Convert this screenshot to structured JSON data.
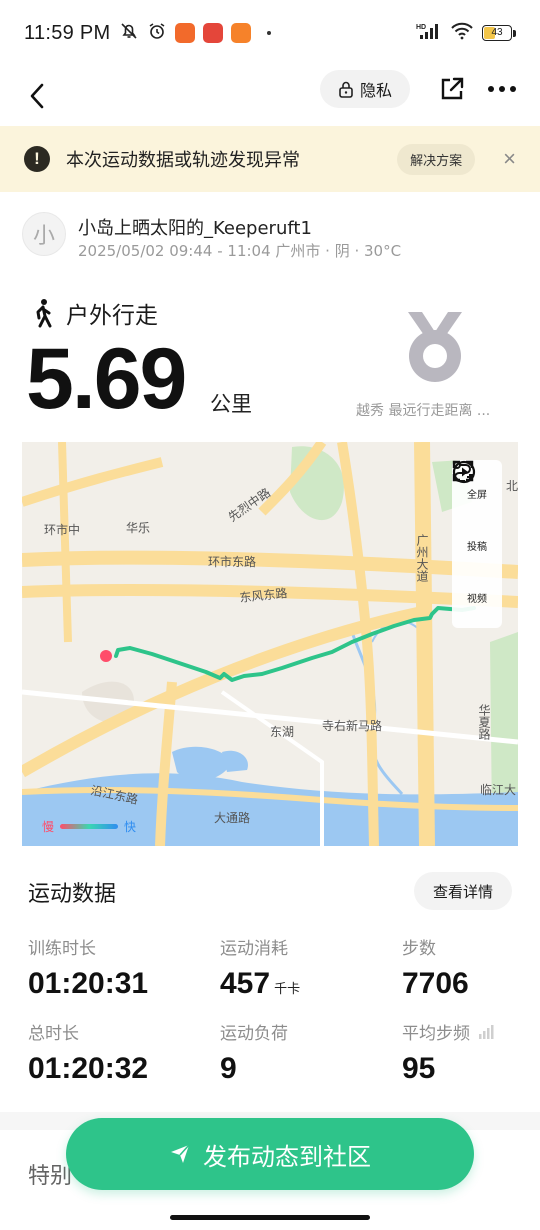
{
  "status_bar": {
    "time": "11:59 PM",
    "network": "HD",
    "battery": "43",
    "battery_level": 0.43,
    "icons": [
      "mute-bell-icon",
      "alarm-icon",
      "app-badge-icon",
      "app-badge-icon",
      "app-badge-icon",
      "signal-icon",
      "wifi-icon",
      "battery-icon"
    ]
  },
  "nav": {
    "back_icon": "chevron-left-icon",
    "privacy_label": "隐私",
    "privacy_icon": "lock-icon",
    "share_icon": "share-icon",
    "more_icon": "more-icon"
  },
  "warning": {
    "text": "本次运动数据或轨迹发现异常",
    "button": "解决方案",
    "close": "×"
  },
  "user": {
    "avatar_text": "小",
    "name": "小岛上晒太阳的_Keeperuft1",
    "meta": "2025/05/02 09:44 - 11:04 广州市 · 阴 · 30°C"
  },
  "activity": {
    "type": "户外行走",
    "distance": "5.69",
    "unit": "公里",
    "medal_label": "越秀 最远行走距离 ..."
  },
  "map": {
    "labels": [
      "环市中",
      "华乐",
      "先烈中路",
      "环市东路",
      "东风东路",
      "东湖",
      "寺右新马路",
      "沿江东路",
      "大通路",
      "广州大道",
      "华夏路",
      "临江大",
      "北"
    ],
    "tools": [
      {
        "label": "全屏",
        "icon": "fullscreen-icon"
      },
      {
        "label": "投稿",
        "icon": "route-add-icon"
      },
      {
        "label": "视频",
        "icon": "play-icon"
      }
    ],
    "legend_slow": "慢",
    "legend_fast": "快",
    "colors": {
      "route": "#2ec48a",
      "start": "#ff4d6a"
    }
  },
  "sports": {
    "title": "运动数据",
    "detail_button": "查看详情",
    "stats": [
      {
        "label": "训练时长",
        "value": "01:20:31",
        "unit": ""
      },
      {
        "label": "运动消耗",
        "value": "457",
        "unit": "千卡"
      },
      {
        "label": "步数",
        "value": "7706",
        "unit": ""
      },
      {
        "label": "总时长",
        "value": "01:20:32",
        "unit": ""
      },
      {
        "label": "运动负荷",
        "value": "9",
        "unit": ""
      },
      {
        "label": "平均步频",
        "value": "95",
        "unit": ""
      }
    ]
  },
  "special_title": "特别",
  "publish_button": "发布动态到社区",
  "accent": "#2ec48a"
}
